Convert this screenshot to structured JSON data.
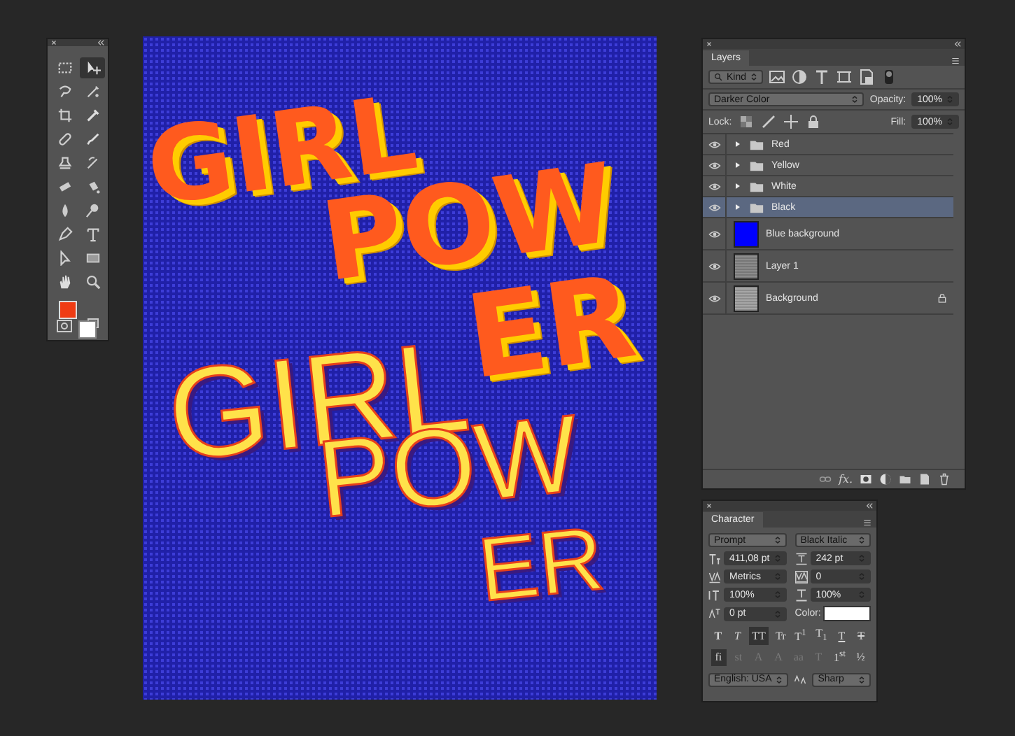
{
  "toolbox": {
    "tools": [
      {
        "kind": "marquee",
        "selected": false
      },
      {
        "kind": "move",
        "selected": true
      },
      {
        "kind": "lasso",
        "selected": false
      },
      {
        "kind": "quick-select",
        "selected": false
      },
      {
        "kind": "crop",
        "selected": false
      },
      {
        "kind": "eyedropper",
        "selected": false
      },
      {
        "kind": "healing",
        "selected": false
      },
      {
        "kind": "brush",
        "selected": false
      },
      {
        "kind": "stamp",
        "selected": false
      },
      {
        "kind": "history-brush",
        "selected": false
      },
      {
        "kind": "eraser",
        "selected": false
      },
      {
        "kind": "bucket",
        "selected": false
      },
      {
        "kind": "blur",
        "selected": false
      },
      {
        "kind": "dodge",
        "selected": false
      },
      {
        "kind": "pen",
        "selected": false
      },
      {
        "kind": "type",
        "selected": false
      },
      {
        "kind": "path-select",
        "selected": false
      },
      {
        "kind": "rectangle",
        "selected": false
      },
      {
        "kind": "hand",
        "selected": false
      },
      {
        "kind": "zoom",
        "selected": false
      }
    ],
    "swatches": [
      {
        "kind": "foreground",
        "color": "#f03c14"
      },
      {
        "kind": "background",
        "color": "#ffffff"
      }
    ]
  },
  "canvas": {
    "texts": [
      {
        "text": "GIRL",
        "kind": "filled"
      },
      {
        "text": "POW",
        "kind": "filled"
      },
      {
        "text": "ER",
        "kind": "filled"
      },
      {
        "text": "GIRL",
        "kind": "outline"
      },
      {
        "text": "POW",
        "kind": "outline"
      },
      {
        "text": "ER",
        "kind": "outline"
      }
    ]
  },
  "layers_panel": {
    "tab": "Layers",
    "filter": "Kind",
    "blend_mode": "Darker Color",
    "opacity_label": "Opacity:",
    "opacity": "100%",
    "lock_label": "Lock:",
    "fill_label": "Fill:",
    "fill": "100%",
    "layers": [
      {
        "name": "Red",
        "kind": "group",
        "visible": true,
        "expanded": false,
        "selected": false,
        "locked": false
      },
      {
        "name": "Yellow",
        "kind": "group",
        "visible": true,
        "expanded": false,
        "selected": false,
        "locked": false
      },
      {
        "name": "White",
        "kind": "group",
        "visible": true,
        "expanded": false,
        "selected": false,
        "locked": false
      },
      {
        "name": "Black",
        "kind": "group",
        "visible": true,
        "expanded": false,
        "selected": true,
        "locked": false
      },
      {
        "name": "Blue background",
        "kind": "fill",
        "color": "#0000ff",
        "visible": true,
        "selected": false,
        "locked": false
      },
      {
        "name": "Layer 1",
        "kind": "pixel",
        "color": "#8c8c8c",
        "visible": true,
        "selected": false,
        "locked": false
      },
      {
        "name": "Background",
        "kind": "pixel",
        "color": "#a6a6a6",
        "visible": true,
        "selected": false,
        "locked": true
      }
    ],
    "fx_label": "fx."
  },
  "character_panel": {
    "tab": "Character",
    "font_family": "Prompt",
    "font_style": "Black Italic",
    "size": "411,08 pt",
    "leading": "242 pt",
    "kerning": "Metrics",
    "tracking": "0",
    "vertical_scale": "100%",
    "horizontal_scale": "100%",
    "baseline_shift": "0 pt",
    "color_label": "Color:",
    "color": "#ffffff",
    "styles": [
      {
        "label": "T",
        "kind": "bold",
        "selected": false
      },
      {
        "label": "T",
        "kind": "italic",
        "selected": false
      },
      {
        "label": "TT",
        "kind": "caps",
        "selected": true
      },
      {
        "label": "Tт",
        "kind": "small-caps",
        "selected": false
      },
      {
        "label": "T$^{1}$",
        "kind": "super",
        "selected": false
      },
      {
        "label": "T$_{1}$",
        "kind": "sub",
        "selected": false
      },
      {
        "label": "T",
        "kind": "underline",
        "selected": false
      },
      {
        "label": "T",
        "kind": "strike",
        "selected": false
      }
    ],
    "opentype": [
      {
        "label": "fi",
        "selected": true,
        "disabled": false
      },
      {
        "label": "st",
        "selected": false,
        "disabled": true
      },
      {
        "label": "A",
        "selected": false,
        "disabled": true
      },
      {
        "label": "A",
        "selected": false,
        "disabled": true
      },
      {
        "label": "aa",
        "selected": false,
        "disabled": true
      },
      {
        "label": "T",
        "selected": false,
        "disabled": true
      },
      {
        "label": "1$^{st}$",
        "selected": false,
        "disabled": false
      },
      {
        "label": "½",
        "selected": false,
        "disabled": false
      }
    ],
    "language": "English: USA",
    "antialias": "Sharp"
  }
}
